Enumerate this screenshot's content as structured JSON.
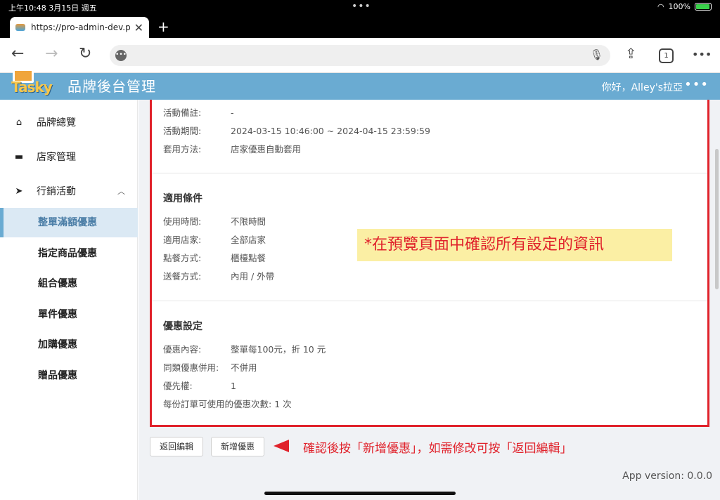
{
  "status": {
    "time": "上午10:48  3月15日 週五",
    "battery": "100%"
  },
  "browser": {
    "tab_title": "https://pro-admin-dev.po",
    "tab_count": "1"
  },
  "app": {
    "logo": "Tasky",
    "title": "品牌後台管理",
    "greeting": "你好，Alley's拉亞"
  },
  "sidebar": {
    "items": [
      {
        "label": "品牌總覽",
        "icon": "home-icon"
      },
      {
        "label": "店家管理",
        "icon": "store-icon"
      },
      {
        "label": "行銷活動",
        "icon": "send-icon"
      }
    ],
    "sub_items": [
      "整單滿額優惠",
      "指定商品優惠",
      "組合優惠",
      "單件優惠",
      "加購優惠",
      "贈品優惠"
    ]
  },
  "detail": {
    "top_rows": [
      {
        "label": "活動備註:",
        "value": "-"
      },
      {
        "label": "活動期間:",
        "value": "2024-03-15 10:46:00 ~ 2024-04-15 23:59:59"
      },
      {
        "label": "套用方法:",
        "value": "店家優惠自動套用"
      }
    ],
    "conditions": {
      "title": "適用條件",
      "rows": [
        {
          "label": "使用時間:",
          "value": "不限時間"
        },
        {
          "label": "適用店家:",
          "value": "全部店家"
        },
        {
          "label": "點餐方式:",
          "value": "櫃檯點餐"
        },
        {
          "label": "送餐方式:",
          "value": "內用 / 外帶"
        }
      ]
    },
    "discount": {
      "title": "優惠設定",
      "rows": [
        {
          "label": "優惠內容:",
          "value": "整單每100元，折 10 元"
        },
        {
          "label": "同類優惠併用:",
          "value": "不併用"
        },
        {
          "label": "優先權:",
          "value": "1"
        },
        {
          "label": "每份訂單可使用的優惠次數:",
          "value": "1 次"
        }
      ]
    }
  },
  "annotation": {
    "note": "*在預覽頁面中確認所有設定的資訊",
    "instruction": "確認後按「新增優惠」，如需修改可按「返回編輯」"
  },
  "buttons": {
    "back": "返回編輯",
    "add": "新增優惠"
  },
  "footer": {
    "version": "App version: 0.0.0"
  },
  "colors": {
    "header": "#6aabd2",
    "highlight": "#e0222b",
    "note_bg": "#fbefa4"
  }
}
